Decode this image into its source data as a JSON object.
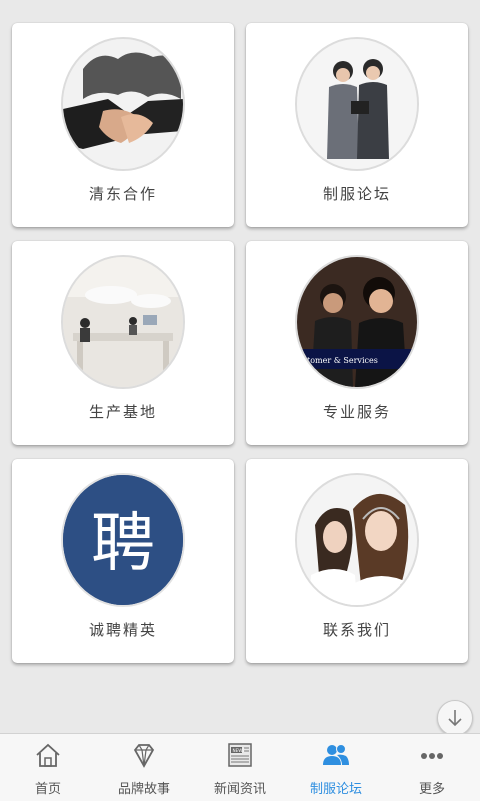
{
  "grid": {
    "items": [
      {
        "label": "清东合作"
      },
      {
        "label": "制服论坛"
      },
      {
        "label": "生产基地"
      },
      {
        "label": "专业服务",
        "banner_text": "tomer & Services"
      },
      {
        "label": "诚聘精英",
        "logo_char": "聘"
      },
      {
        "label": "联系我们"
      }
    ]
  },
  "tabbar": {
    "items": [
      {
        "label": "首页",
        "icon": "home-icon"
      },
      {
        "label": "品牌故事",
        "icon": "diamond-icon"
      },
      {
        "label": "新闻资讯",
        "icon": "news-icon",
        "icon_text": "NEWS"
      },
      {
        "label": "制服论坛",
        "icon": "users-icon",
        "active": true
      },
      {
        "label": "更多",
        "icon": "more-icon"
      }
    ],
    "active_color": "#2f8fe0"
  }
}
